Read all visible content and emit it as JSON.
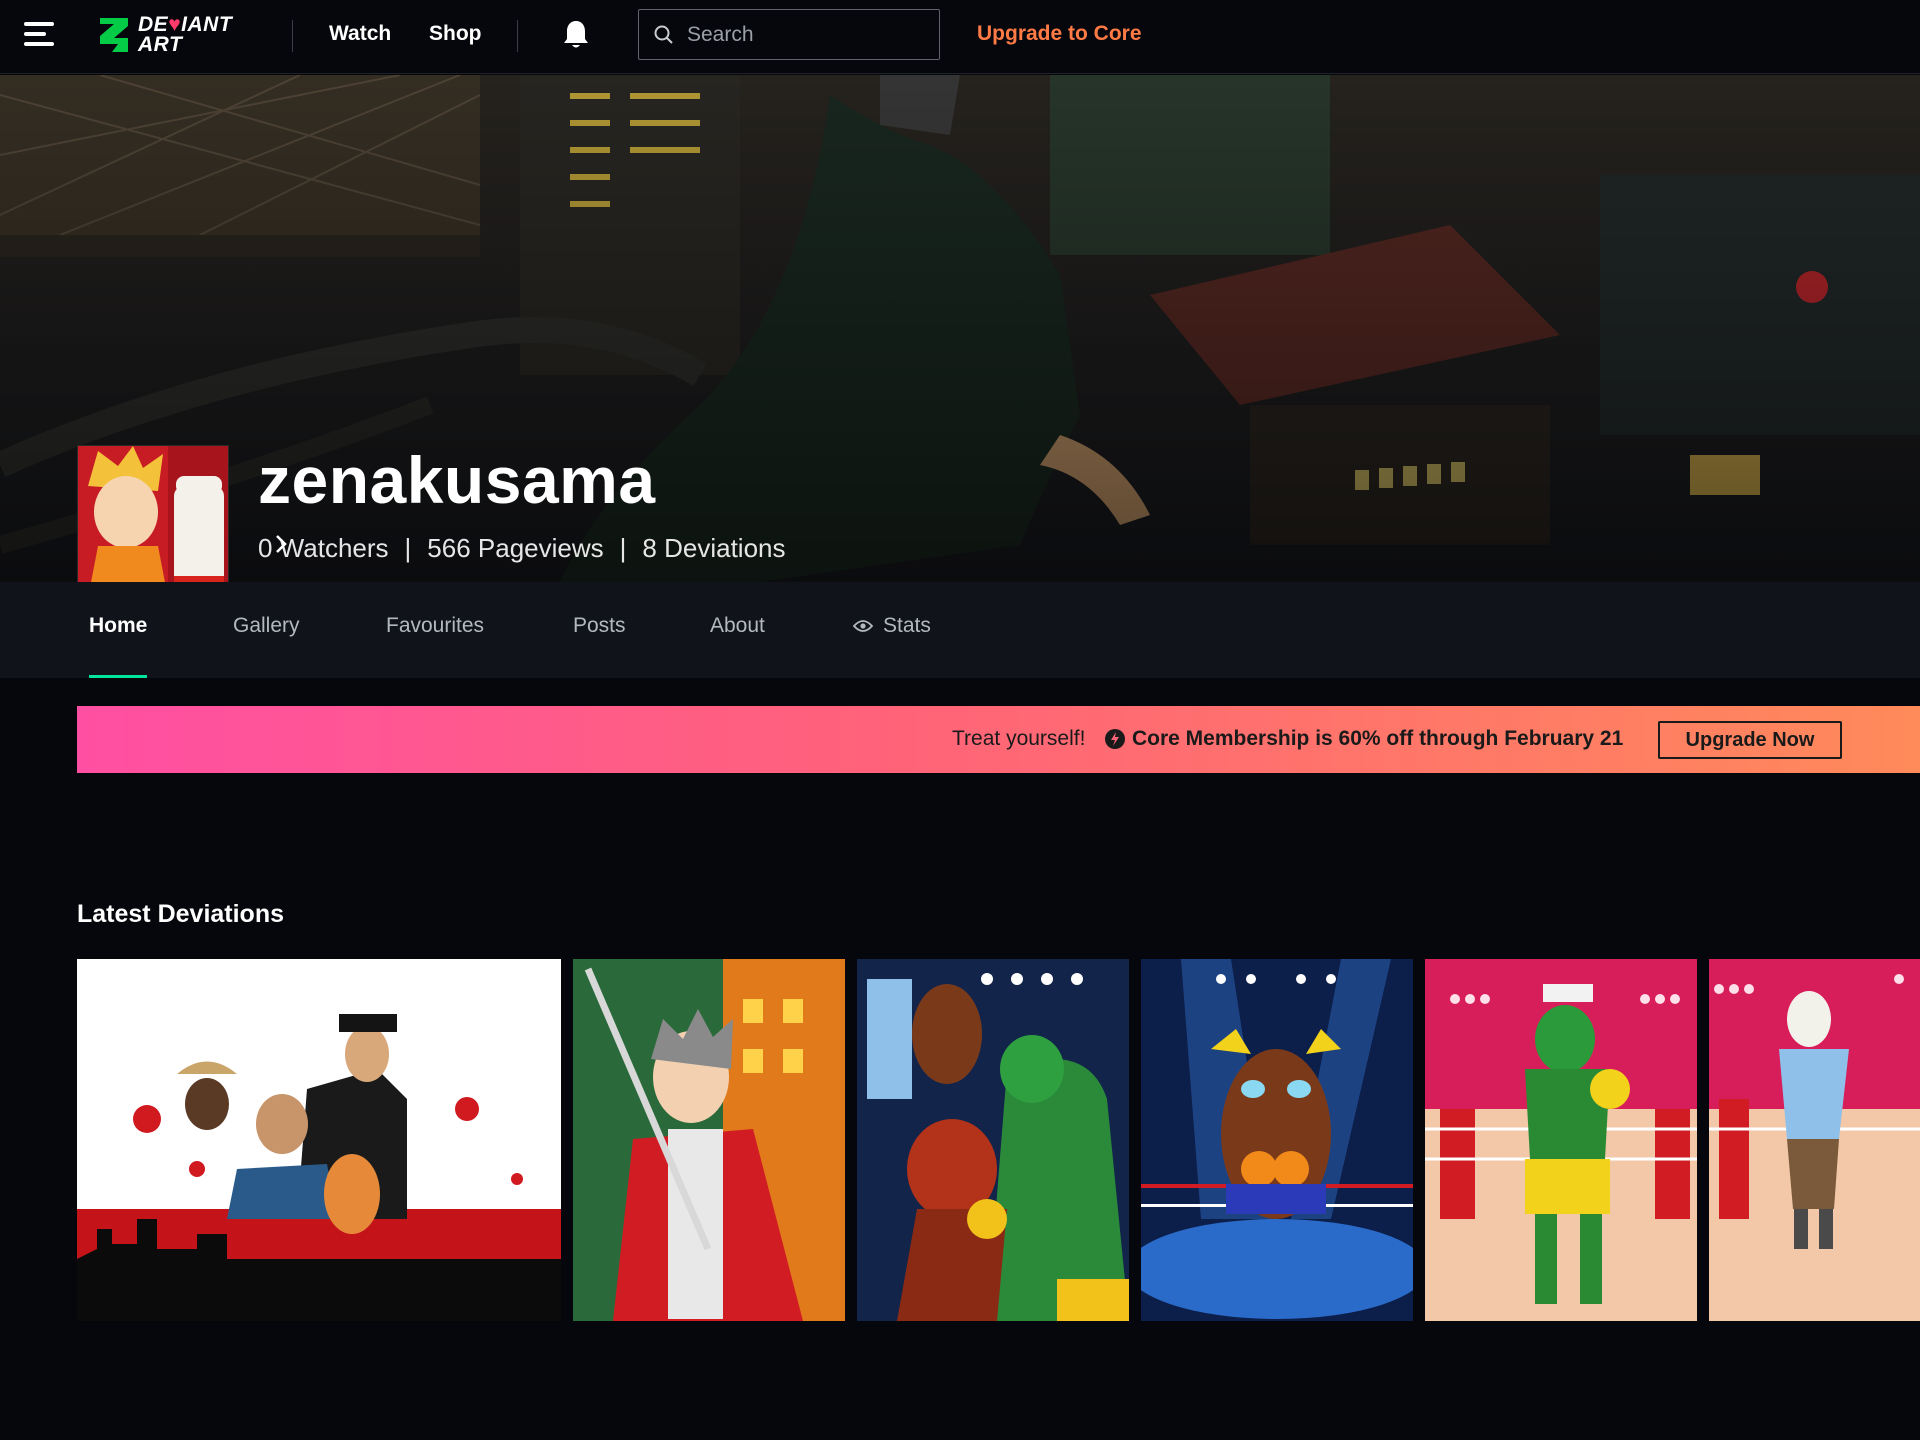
{
  "topbar": {
    "logo_line1": "DE",
    "logo_heart": "♥",
    "logo_line1b": "IANT",
    "logo_line2": "ART",
    "nav": [
      "Watch",
      "Shop"
    ],
    "search_placeholder": "Search",
    "upgrade_label": "Upgrade to Core"
  },
  "profile": {
    "username": "zenakusama",
    "watchers": "0 Watchers",
    "pageviews": "566 Pageviews",
    "deviations": "8 Deviations",
    "separator": "|"
  },
  "tabs": [
    "Home",
    "Gallery",
    "Favourites",
    "Posts",
    "About",
    "Stats"
  ],
  "active_tab": "Home",
  "promo": {
    "treat": "Treat yourself!",
    "core": "Core Membership is 60% off through February 21",
    "button": "Upgrade Now"
  },
  "latest": {
    "title": "Latest Deviations",
    "items": [
      {
        "subject": "gangster poster on red city skyline"
      },
      {
        "subject": "swordsman in red jacket"
      },
      {
        "subject": "boxing match collage"
      },
      {
        "subject": "cartoon character in boxing ring"
      },
      {
        "subject": "green boxer in pink ring"
      },
      {
        "subject": "llama in pink ring"
      }
    ]
  },
  "colors": {
    "accent_green": "#00e59b",
    "upgrade_orange": "#ff7a45",
    "promo_start": "#ff4fa3",
    "promo_end": "#ff8a5a"
  }
}
